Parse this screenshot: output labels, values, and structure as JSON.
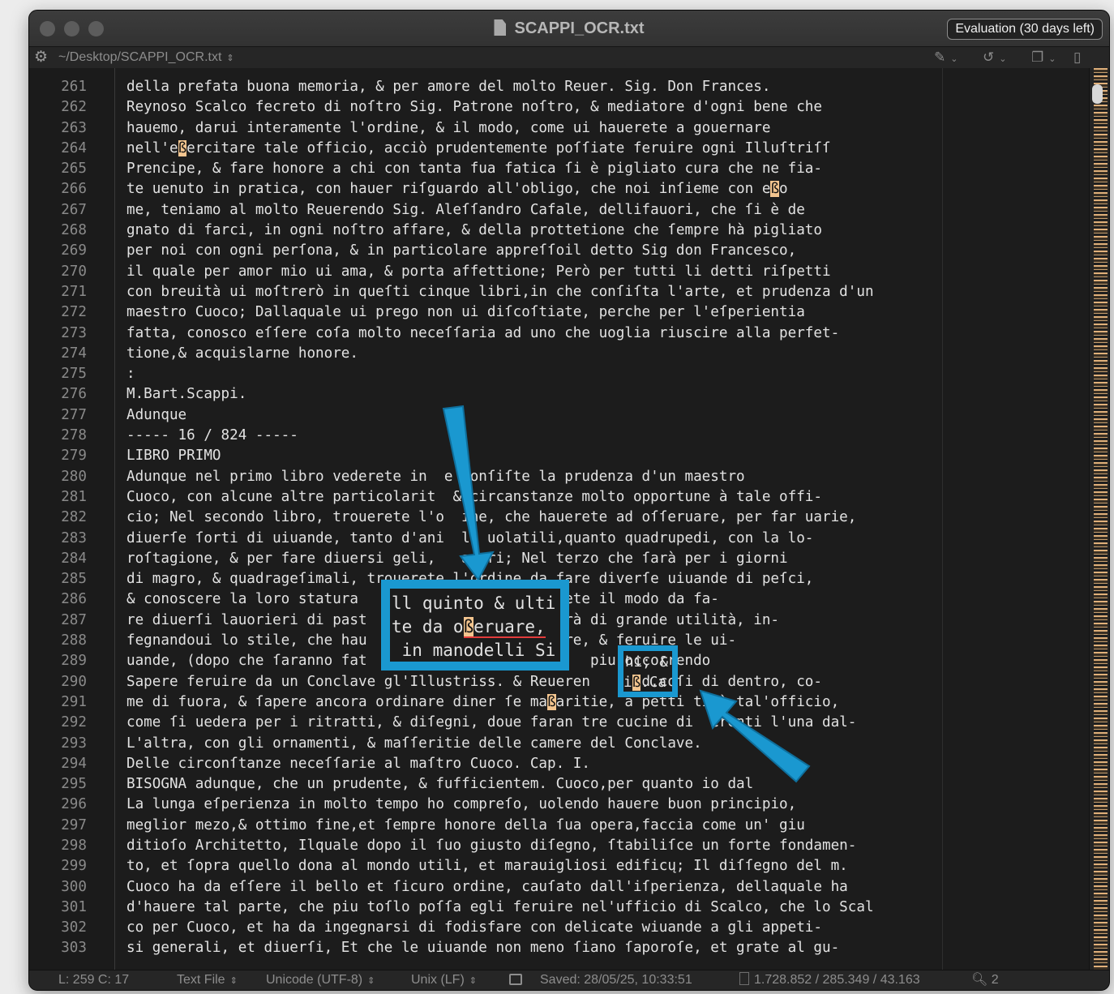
{
  "window": {
    "title": "SCAPPI_OCR.txt",
    "badge": "Evaluation (30 days left)"
  },
  "pathbar": {
    "path": "~/Desktop/SCAPPI_OCR.txt"
  },
  "lines": [
    {
      "n": "261",
      "t": "della prefata buona memoria, & per amore del molto Reuer. Sig. Don Frances."
    },
    {
      "n": "262",
      "t": "Reynoso Scalco fecreto di noſtro Sig. Patrone noſtro, & mediatore d'ogni bene che"
    },
    {
      "n": "263",
      "t": "hauemo, darui interamente l'ordine, & il modo, come ui hauerete a gouernare"
    },
    {
      "n": "264",
      "pre": "nell'e",
      "hl": "ß",
      "post": "ercitare tale officio, acciò prudentemente poſſiate feruire ogni Illuſtriſſ"
    },
    {
      "n": "265",
      "t": "Prencipe, & fare honore a chi con tanta fua fatica ſi è pigliato cura che ne fia-"
    },
    {
      "n": "266",
      "pre": "te uenuto in pratica, con hauer riſguardo all'obligo, che noi inſieme con e",
      "hl": "ß",
      "post": "o"
    },
    {
      "n": "267",
      "t": "me, teniamo al molto Reuerendo Sig. Aleſſandro Cafale, dellifauori, che ſi è de"
    },
    {
      "n": "268",
      "t": "gnato di farci, in ogni noſtro affare, & della prottetione che ſempre hà pigliato"
    },
    {
      "n": "269",
      "t": "per noi con ogni perſona, & in particolare appreſſoil detto Sig don Francesco,"
    },
    {
      "n": "270",
      "t": "il quale per amor mio ui ama, & porta affettione; Però per tutti li detti riſpetti"
    },
    {
      "n": "271",
      "t": "con breuità ui moſtrerò in queſti cinque libri,in che conſiſta l'arte, et prudenza d'un"
    },
    {
      "n": "272",
      "t": "maestro Cuoco; Dallaquale ui prego non ui diſcoſtiate, perche per l'eſperientia"
    },
    {
      "n": "273",
      "t": "fatta, conosco eſſere coſa molto neceſſaria ad uno che uoglia riuscire alla perfet-"
    },
    {
      "n": "274",
      "t": "tione,& acquislarne honore."
    },
    {
      "n": "275",
      "t": ":"
    },
    {
      "n": "276",
      "t": "M.Bart.Scappi."
    },
    {
      "n": "277",
      "t": "Adunque"
    },
    {
      "n": "278",
      "t": "----- 16 / 824 -----"
    },
    {
      "n": "279",
      "t": "LIBRO PRIMO"
    },
    {
      "n": "280",
      "t": "Adunque nel primo libro vederete in  e conſiſte la prudenza d'un maestro"
    },
    {
      "n": "281",
      "t": "Cuoco, con alcune altre particolarit  & circanstanze molto opportune à tale offi-"
    },
    {
      "n": "282",
      "t": "cio; Nel secondo libro, trouerete l'o  ine, che hauerete ad oſſeruare, per far uarie,"
    },
    {
      "n": "283",
      "t": "diuerſe ſorti di uiuande, tanto d'ani  li uolatili,quanto quadrupedi, con la lo-"
    },
    {
      "n": "284",
      "t": "roſtagione, & per fare diuersi geli,   apori; Nel terzo che ſarà per i giorni"
    },
    {
      "n": "285",
      "t": "di magro, & quadrageſimali, trouerete l'ordine da fare diverſe uiuande di peſci,"
    },
    {
      "n": "286",
      "t": "& conoscere la loro statura                o trouerete il modo da fa-"
    },
    {
      "n": "287",
      "t": "re diuerſi lauorieri di past                , ui ſarà di grande utilità, in-"
    },
    {
      "n": "288",
      "t": "fegnandoui lo stile, che hau               preſentare, & feruire le ui-"
    },
    {
      "n": "289",
      "t": "uande, (dopo che ſaranno fat               Scal       piu occorrendo"
    },
    {
      "n": "290",
      "t": "Sapere feruire da un Conclave gl'Illustriss. & Reueren      d.coſi di dentro, co-"
    },
    {
      "n": "291",
      "pre": "me di fuora, & ſapere ancora ordinare diner ſe ma",
      "hl": "ß",
      "post": "aritie, a petti ti à tal'officio,"
    },
    {
      "n": "292",
      "t": "come ſi uedera per i ritratti, & diſegni, doue faran tre cucine di  erenti l'una dal-"
    },
    {
      "n": "293",
      "t": "L'altra, con gli ornamenti, & maſſeritie delle camere del Conclave."
    },
    {
      "n": "294",
      "t": "Delle circonſtanze neceſſarie al maſtro Cuoco. Cap. I."
    },
    {
      "n": "295",
      "t": "BISOGNA adunque, che un prudente, & fufficientem. Cuoco,per quanto io dal"
    },
    {
      "n": "296",
      "t": "La lunga eſperienza in molto tempo ho compreſo, uolendo hauere buon principio,"
    },
    {
      "n": "297",
      "t": "meglior mezo,& ottimo fine,et ſempre honore della ſua opera,faccia come un' giu"
    },
    {
      "n": "298",
      "t": "ditioſo Architetto, Ilquale dopo il ſuo giusto diſegno, ſtabiliſce un forte fondamen-"
    },
    {
      "n": "299",
      "t": "to, et ſopra quello dona al mondo utili, et marauigliosi edificų; Il diſſegno del m."
    },
    {
      "n": "300",
      "t": "Cuoco ha da eſſere il bello et ſicuro ordine, cauſato dall'iſperienza, dellaquale ha"
    },
    {
      "n": "301",
      "t": "d'hauere tal parte, che piu toſlo poſſa egli feruire nel'ufficio di Scalco, che lo Scal"
    },
    {
      "n": "302",
      "t": "co per Cuoco, et ha da ingegnarsi di fodisfare con delicate wiuande a gli appeti-"
    },
    {
      "n": "303",
      "t": "si generali, et diuerſi, Et che le uiuande non meno ſiano ſaporoſe, et grate al gu-"
    }
  ],
  "zoom": {
    "line1": "ll quinto & ulti",
    "line2_pre": "te da o",
    "line2_hl": "ß",
    "line2_post": "eruare,",
    "line3": " in manodelli Si"
  },
  "small_zoom": {
    "line1": "hi; &",
    "line2_pre": "i",
    "line2_hl": "ß",
    "line2_post": ".Ca"
  },
  "status": {
    "position": "L: 259 C: 17",
    "file_type": "Text File",
    "encoding": "Unicode (UTF-8)",
    "line_endings": "Unix (LF)",
    "saved": "Saved: 28/05/25, 10:33:51",
    "counts": "1.728.852 / 285.349 / 43.163",
    "zoom_level": "2"
  },
  "colors": {
    "annotation": "#1a98d0",
    "highlight": "#f3c58f",
    "editor_bg": "#1c1c1c"
  }
}
